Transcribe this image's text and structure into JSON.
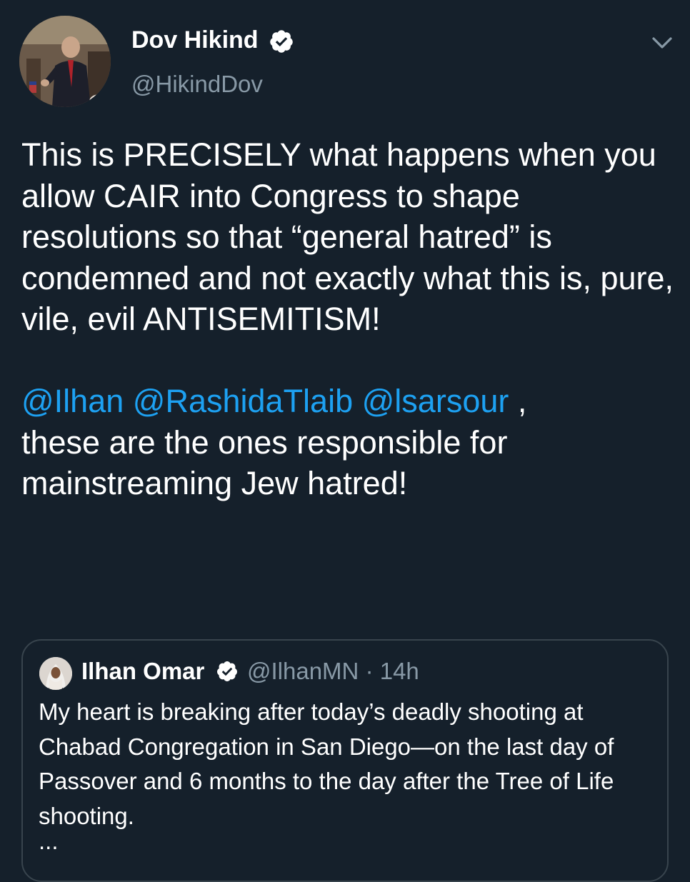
{
  "tweet": {
    "author": {
      "name": "Dov Hikind",
      "handle": "@HikindDov",
      "verified": true,
      "avatar_icon": "profile-photo"
    },
    "menu_icon": "chevron-down-icon",
    "paragraph1": "This is PRECISELY what happens when you allow CAIR into Congress to shape resolutions so that “general hatred” is condemned and not exactly what this is, pure, vile, evil ANTISEMITISM!",
    "mentions": [
      "@Ilhan",
      "@RashidaTlaib",
      "@lsarsour"
    ],
    "paragraph2_after_mentions": " ,",
    "paragraph2_rest": "these are the ones responsible for mainstreaming Jew hatred!"
  },
  "quoted_tweet": {
    "name": "Ilhan Omar",
    "verified": true,
    "handle": "@IlhanMN",
    "time": "· 14h",
    "text": "My heart is breaking after today’s deadly shooting at Chabad Congregation in San Diego—on the last day of Passover and 6 months to the day after the Tree of Life shooting.",
    "truncation": "..."
  },
  "colors": {
    "background": "#15202b",
    "text": "#ffffff",
    "secondary_text": "#8899a6",
    "link": "#1da1f2",
    "border": "#38444d",
    "verified_badge": "#ffffff"
  }
}
